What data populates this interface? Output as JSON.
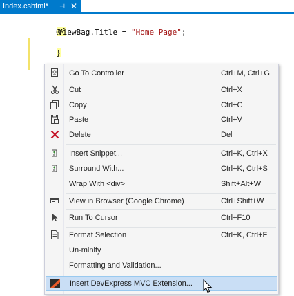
{
  "tab": {
    "title": "Index.cshtml*",
    "pin_glyph": "⊣",
    "close_glyph": "✕"
  },
  "code": {
    "line1": "@{",
    "line2_prop": "ViewBag.Title",
    "line2_op": " = ",
    "line2_str": "\"Home Page\"",
    "line2_end": ";",
    "line3": "}"
  },
  "menu": {
    "items": [
      {
        "label": "Go To Controller",
        "shortcut": "Ctrl+M, Ctrl+G",
        "icon": "go-to-controller-icon"
      },
      {
        "label": "Cut",
        "shortcut": "Ctrl+X",
        "icon": "scissors-icon"
      },
      {
        "label": "Copy",
        "shortcut": "Ctrl+C",
        "icon": "copy-icon"
      },
      {
        "label": "Paste",
        "shortcut": "Ctrl+V",
        "icon": "clipboard-icon"
      },
      {
        "label": "Delete",
        "shortcut": "Del",
        "icon": "delete-x-icon"
      },
      {
        "label": "Insert Snippet...",
        "shortcut": "Ctrl+K, Ctrl+X",
        "icon": "snippet-icon"
      },
      {
        "label": "Surround With...",
        "shortcut": "Ctrl+K, Ctrl+S",
        "icon": "surround-icon"
      },
      {
        "label": "Wrap With <div>",
        "shortcut": "Shift+Alt+W",
        "icon": ""
      },
      {
        "label": "View in Browser (Google Chrome)",
        "shortcut": "Ctrl+Shift+W",
        "icon": "browser-icon"
      },
      {
        "label": "Run To Cursor",
        "shortcut": "Ctrl+F10",
        "icon": "run-to-cursor-icon"
      },
      {
        "label": "Format Selection",
        "shortcut": "Ctrl+K, Ctrl+F",
        "icon": "format-icon"
      },
      {
        "label": "Un-minify",
        "shortcut": "",
        "icon": ""
      },
      {
        "label": "Formatting and Validation...",
        "shortcut": "",
        "icon": ""
      },
      {
        "label": "Insert DevExpress MVC Extension...",
        "shortcut": "",
        "icon": "devexpress-icon"
      }
    ]
  },
  "colors": {
    "accent": "#007acc",
    "highlight": "#c9def5",
    "delete_red": "#c4162a"
  }
}
